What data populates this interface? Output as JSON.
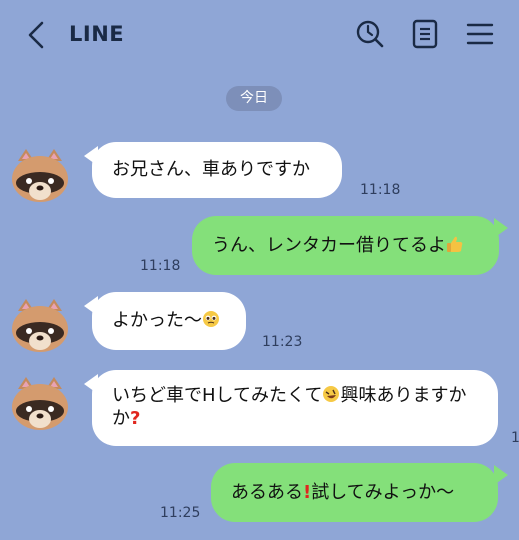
{
  "header": {
    "title": "LINE",
    "icons": [
      "back-arrow-icon",
      "search-clock-icon",
      "notes-icon",
      "menu-icon"
    ]
  },
  "date_chip": "今日",
  "messages": [
    {
      "side": "in",
      "text": "お兄さん、車ありですか",
      "time": "11:18"
    },
    {
      "side": "out",
      "text": "うん、レンタカー借りてるよ",
      "emoji": "thumbs-up",
      "time": "11:18"
    },
    {
      "side": "in",
      "text": "よかった〜",
      "emoji": "pleading-face",
      "time": "11:23"
    },
    {
      "side": "in",
      "line1": "いちど車でHしてみたくて",
      "emoji_mid": "rolling-laughing-face",
      "line1b": "興味ありますか",
      "line2": "か",
      "emoji_end": "red-question-mark"
    },
    {
      "side": "out",
      "text_a": "あるある",
      "emoji": "red-exclamation-mark",
      "text_b": "試してみよっか〜",
      "time": "11:25"
    }
  ],
  "colors": {
    "background": "#8fa6d6",
    "incoming_bubble": "#ffffff",
    "outgoing_bubble": "#84e07a"
  }
}
